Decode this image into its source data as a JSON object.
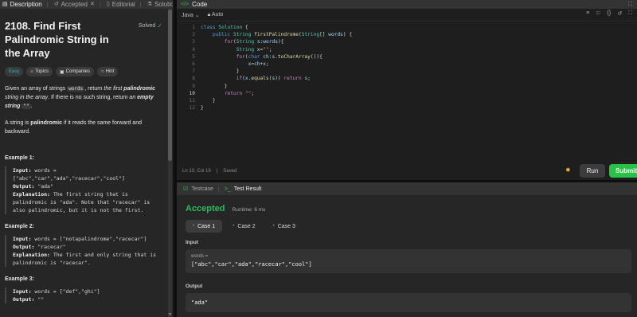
{
  "left_tabs": [
    {
      "label": "Description",
      "icon": "description-icon"
    },
    {
      "label": "Accepted",
      "icon": "history-icon"
    },
    {
      "label": "Editorial",
      "icon": "book-icon"
    },
    {
      "label": "Solutions",
      "icon": "flask-icon"
    }
  ],
  "problem": {
    "title": "2108. Find First Palindromic String in the Array",
    "status": "Solved",
    "chips": {
      "difficulty": "Easy",
      "topics": "Topics",
      "companies": "Companies",
      "hint": "Hint"
    },
    "p1": {
      "a": "Given an array of strings ",
      "code_words": "words",
      "b": ", return ",
      "em1": "the first ",
      "strong1": "palindromic",
      "em2": " string in the array",
      "c": ". If there is no such string, return ",
      "em3": "an ",
      "strong2": "empty string",
      "code_empty": "\"\"",
      "d": "."
    },
    "p2": {
      "a": "A string is ",
      "strong": "palindromic",
      "b": " if it reads the same forward and backward."
    },
    "examples": [
      {
        "heading": "Example 1:",
        "input_label": "Input:",
        "input": " words = [\"abc\",\"car\",\"ada\",\"racecar\",\"cool\"]",
        "output_label": "Output:",
        "output": " \"ada\"",
        "explanation_label": "Explanation:",
        "explanation": " The first string that is palindromic is \"ada\". Note that \"racecar\" is also palindromic, but it is not the first."
      },
      {
        "heading": "Example 2:",
        "input_label": "Input:",
        "input": " words = [\"notapalindrome\",\"racecar\"]",
        "output_label": "Output:",
        "output": " \"racecar\"",
        "explanation_label": "Explanation:",
        "explanation": " The first and only string that is palindromic is \"racecar\"."
      },
      {
        "heading": "Example 3:",
        "input_label": "Input:",
        "input": " words = [\"def\",\"ghi\"]",
        "output_label": "Output:",
        "output": " \"\""
      }
    ]
  },
  "code_panel": {
    "title": "Code",
    "language": "Java",
    "mode": "Auto",
    "status_position": "Ln 10, Col 19",
    "status_saved": "Saved",
    "run_label": "Run",
    "submit_label": "Submit",
    "current_line": 10,
    "lines": [
      "<span class=\"kw\">class</span> <span class=\"ty\">Solution</span> {",
      "    <span class=\"kw\">public</span> <span class=\"ty\">String</span> <span class=\"fn\">firstPalindrome</span>(<span class=\"ty\">String</span>[] <span class=\"vr\">words</span>) {",
      "        <span class=\"cf\">for</span>(<span class=\"ty\">String</span> <span class=\"vr\">s</span>:<span class=\"vr\">words</span>){",
      "            <span class=\"ty\">String</span> <span class=\"vr\">x</span>=<span class=\"st\">\"\"</span>;",
      "            <span class=\"cf\">for</span>(<span class=\"kw\">char</span> <span class=\"vr\">ch</span>:<span class=\"vr\">s</span>.<span class=\"fn\">toCharArray</span>()){",
      "                <span class=\"vr\">x</span>=<span class=\"vr\">ch</span>+<span class=\"vr\">x</span>;",
      "            }",
      "            <span class=\"cf\">if</span>(<span class=\"vr\">x</span>.<span class=\"fn\">equals</span>(<span class=\"vr\">s</span>)) <span class=\"cf\">return</span> <span class=\"vr\">s</span>;",
      "        }",
      "        <span class=\"cf\">return</span> <span class=\"st\">\"\"</span>;",
      "    }",
      "}"
    ]
  },
  "test_panel": {
    "tab_testcase": "Testcase",
    "tab_result": "Test Result",
    "verdict": "Accepted",
    "runtime": "Runtime: 6 ms",
    "cases": [
      "Case 1",
      "Case 2",
      "Case 3"
    ],
    "input_label": "Input",
    "input_var": "words =",
    "input_value": "[\"abc\",\"car\",\"ada\",\"racecar\",\"cool\"]",
    "output_label": "Output",
    "output_value": "\"ada\""
  },
  "colors": {
    "accent_green": "#2cbb5d",
    "easy_teal": "#1cb8b8",
    "submit_green": "#28c244"
  }
}
